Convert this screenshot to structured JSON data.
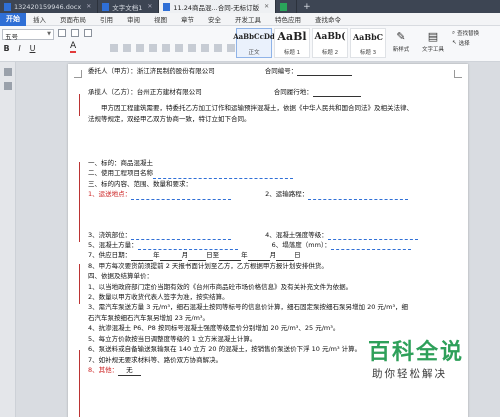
{
  "tabs": [
    {
      "label": "132420159946.docx",
      "type": "w",
      "active": false
    },
    {
      "label": "文字文档1",
      "type": "w",
      "active": false
    },
    {
      "label": "11.24商品混...合同-无标订版",
      "type": "w",
      "active": true
    },
    {
      "label": "",
      "type": "s",
      "active": false
    }
  ],
  "menu": {
    "start": "开始",
    "items": [
      "插入",
      "页面布局",
      "引用",
      "审阅",
      "视图",
      "章节",
      "安全",
      "开发工具",
      "特色应用",
      "查找命令"
    ]
  },
  "ribbon": {
    "font_name": "五号",
    "font_color_glyph": "A",
    "format_glyphs": [
      "B",
      "I",
      "U"
    ],
    "styles": [
      {
        "preview": "AaBbCcDd",
        "label": "正文"
      },
      {
        "preview": "AaBl",
        "label": "标题 1"
      },
      {
        "preview": "AaBb(",
        "label": "标题 2"
      },
      {
        "preview": "AaBbC",
        "label": "标题 3"
      }
    ],
    "new_style": "新样式",
    "text_tools": "文字工具",
    "find_replace": "查找替换",
    "select": "选择"
  },
  "doc": {
    "party_a_label": "委托人（甲方）：浙江济民制药股份有限公司",
    "contract_no_label": "合同编号：",
    "party_b_label": "承揽人（乙方）：台州正方建材有限公司",
    "sign_date_label": "合同履行地：",
    "intro_1": "甲方因工程建筑需要，特委托乙方加工订作和运输预拌混凝土，依据《中华人民共和国合同法》及相关法律、",
    "intro_2": "法规等规定，双经甲乙双方协商一致，特订立如下合同。",
    "s1": "一、标的：商品混凝土",
    "s2": "二、使用工程项目名称",
    "s3": "三、标的内容、范围、数量和要求：",
    "item1": "1、运送地点：",
    "item2": "2、运输路程：",
    "item3": "3、浇筑部位：",
    "item4": "4、混凝土强度等级：",
    "item5": "5、混凝土方量：",
    "item6": "6、塌落度（mm）：",
    "item7": "7、供应日期：",
    "item7_year": "年",
    "item7_month": "月",
    "item7_day": "日至",
    "item7_year2": "年",
    "item7_month2": "月",
    "item7_day2": "日",
    "item8": "8、甲方每次要货前须提前 2 天报书面计划至乙方，乙方根据甲方报计划安排供货。",
    "s4": "四、依据及结算单价：",
    "p1": "1、以当地政府部门定价当期有效的《台州市商品砼市场价格信息》及有关补充文件为依据。",
    "p2": "2、数量以甲方收货代表人签字为准，按实结算。",
    "p3a": "3、需汽车泵送方量 3 元/m³，细石混凝土按同等标号的信息价计算，细石固定泵按细石泵另增加 20 元/m³，细",
    "p3b": "石汽车泵按细石汽车泵另增加 23 元/m³。",
    "p4": "4、抗渗混凝土 P6、P8 按同标号混凝土强度等级是价分别增加 20 元/m³、25 元/m³。",
    "p5": "5、每立方价款按当日调整度等级的 1 立方米混凝土计算。",
    "p6": "6、泵送料或自备输送泵输泵在 140 立方 20 的混凝土，按销售价泵送价下浮 10 元/m³ 计算。",
    "p7": "7、如补规无要求材料等、路价双方协商解决。",
    "p8_label": "8、其他：",
    "p8_value": "无"
  },
  "watermark": {
    "title": "百科全说",
    "subtitle": "助你轻松解决"
  },
  "colors": {
    "tabbar": "#3d4553",
    "accent": "#2f6fd6",
    "watermark_green": "#2ea05a",
    "red_mark": "#cc2222"
  }
}
